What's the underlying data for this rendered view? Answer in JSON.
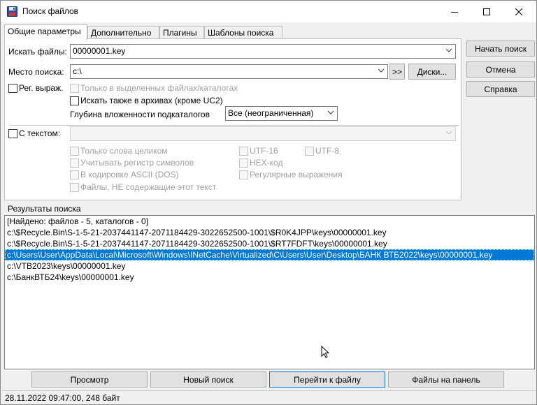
{
  "window": {
    "title": "Поиск файлов"
  },
  "tabs": [
    {
      "label": "Общие параметры",
      "active": true
    },
    {
      "label": "Дополнительно",
      "active": false
    },
    {
      "label": "Плагины",
      "active": false
    },
    {
      "label": "Шаблоны поиска",
      "active": false
    }
  ],
  "general": {
    "search_files_label": "Искать файлы:",
    "search_files_value": "00000001.key",
    "location_label": "Место поиска:",
    "location_value": "c:\\",
    "browse_button": ">>",
    "drives_button": "Диски...",
    "regex_label": "Рег. выраж.",
    "only_selected_label": "Только в выделенных файлах/каталогах",
    "search_archives_label": "Искать также в архивах (кроме UC2)",
    "depth_label": "Глубина вложенности подкаталогов",
    "depth_value": "Все (неограниченная)",
    "with_text_label": "С текстом:",
    "with_text_value": "",
    "whole_words_label": "Только слова целиком",
    "case_label": "Учитывать регистр символов",
    "ascii_label": "В кодировке ASCII (DOS)",
    "not_containing_label": "Файлы, НЕ содержащие этот текст",
    "utf16_label": "UTF-16",
    "utf8_label": "UTF-8",
    "hex_label": "HEX-код",
    "regex2_label": "Регулярные выражения"
  },
  "side_buttons": {
    "start": "Начать поиск",
    "cancel": "Отмена",
    "help": "Справка"
  },
  "results": {
    "label": "Результаты поиска",
    "rows": [
      {
        "text": "[Найдено: файлов - 5, каталогов - 0]",
        "selected": false
      },
      {
        "text": "c:\\$Recycle.Bin\\S-1-5-21-2037441147-2071184429-3022652500-1001\\$R0K4JPP\\keys\\00000001.key",
        "selected": false
      },
      {
        "text": "c:\\$Recycle.Bin\\S-1-5-21-2037441147-2071184429-3022652500-1001\\$RT7FDFT\\keys\\00000001.key",
        "selected": false
      },
      {
        "text": "c:\\Users\\User\\AppData\\Local\\Microsoft\\Windows\\INetCache\\Virtualized\\C\\Users\\User\\Desktop\\БАНК ВТБ2022\\keys\\00000001.key",
        "selected": true
      },
      {
        "text": "c:\\VTB2023\\keys\\00000001.key",
        "selected": false
      },
      {
        "text": "c:\\БанкВТБ24\\keys\\00000001.key",
        "selected": false
      }
    ]
  },
  "bottom_buttons": {
    "view": "Просмотр",
    "new_search": "Новый поиск",
    "go_to_file": "Перейти к файлу",
    "files_to_panel": "Файлы на панель"
  },
  "status": {
    "text": "28.11.2022 09:47:00, 248 байт"
  },
  "colors": {
    "selection": "#0078d7",
    "focus_border": "#0078d7"
  }
}
